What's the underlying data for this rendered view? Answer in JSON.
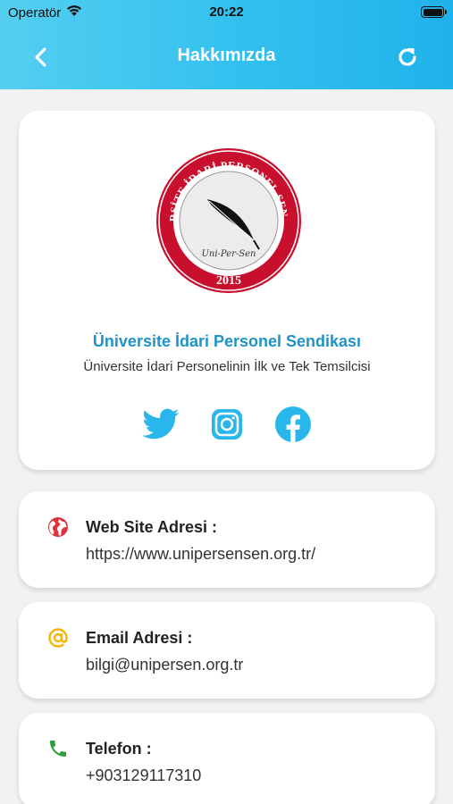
{
  "status_bar": {
    "carrier": "Operatör",
    "time": "20:22"
  },
  "nav": {
    "title": "Hakkımızda"
  },
  "profile": {
    "logo_text": "ÜNİVERSİTE İDARİ PERSONEL SENDİKASI",
    "logo_year": "2015",
    "logo_script": "Uni-Per-Sen",
    "name": "Üniversite İdari Personel Sendikası",
    "tagline": "Üniversite İdari Personelinin İlk ve Tek Temsilcisi",
    "socials": [
      "twitter-icon",
      "instagram-icon",
      "facebook-icon"
    ]
  },
  "contacts": [
    {
      "icon": "globe-icon",
      "label": "Web Site Adresi :",
      "value": "https://www.unipersensen.org.tr/"
    },
    {
      "icon": "at-icon",
      "label": "Email Adresi :",
      "value": "bilgi@unipersen.org.tr"
    },
    {
      "icon": "phone-icon",
      "label": "Telefon :",
      "value": "+903129117310"
    }
  ],
  "colors": {
    "header_start": "#54cff0",
    "header_end": "#1fb2ea",
    "accent": "#1f93c8",
    "social": "#29b6ea",
    "globe": "#e0303a",
    "at": "#f5b400",
    "phone": "#2e9d3a",
    "logo_red": "#c8102e"
  }
}
